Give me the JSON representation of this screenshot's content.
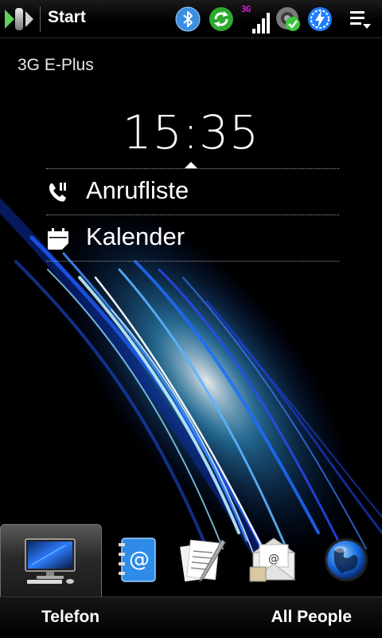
{
  "title_bar": {
    "title": "Start",
    "network_type": "3G",
    "icons": [
      "start-logo-icon",
      "bluetooth-icon",
      "sync-icon",
      "signal-strength-icon",
      "settings-ok-icon",
      "power-icon",
      "menu-icon"
    ]
  },
  "home": {
    "operator": "3G E-Plus",
    "clock": "15:35",
    "rows": [
      {
        "label": "Anrufliste",
        "icon": "missed-call-icon"
      },
      {
        "label": "Kalender",
        "icon": "calendar-icon"
      }
    ]
  },
  "tabs": {
    "items": [
      {
        "icon": "home-computer-icon",
        "selected": true
      },
      {
        "icon": "contacts-book-icon",
        "selected": false
      },
      {
        "icon": "messages-icon",
        "selected": false
      },
      {
        "icon": "mail-icon",
        "selected": false
      },
      {
        "icon": "internet-globe-icon",
        "selected": false
      }
    ]
  },
  "softkeys": {
    "left": "Telefon",
    "right": "All People"
  },
  "colors": {
    "accent_blue": "#1e7dff",
    "wallpaper_glow": "#7fe0ff",
    "network_type": "#d020d0",
    "ok_green": "#3cc83c"
  }
}
